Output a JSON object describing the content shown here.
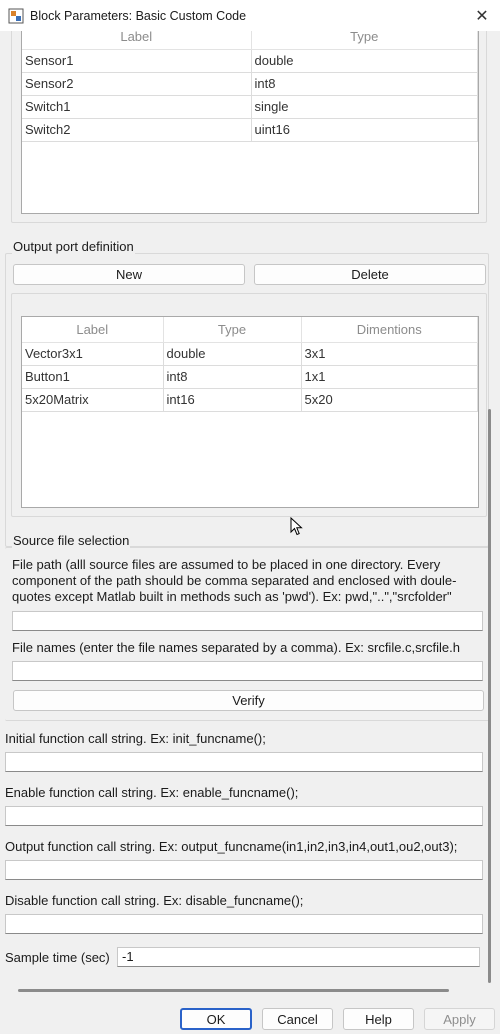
{
  "window": {
    "title": "Block Parameters: Basic Custom Code"
  },
  "input_ports": {
    "columns": [
      "Label",
      "Type"
    ],
    "rows": [
      [
        "Sensor1",
        "double"
      ],
      [
        "Sensor2",
        "int8"
      ],
      [
        "Switch1",
        "single"
      ],
      [
        "Switch2",
        "uint16"
      ]
    ]
  },
  "output_ports": {
    "group_title": "Output port definition",
    "new_label": "New",
    "delete_label": "Delete",
    "columns": [
      "Label",
      "Type",
      "Dimentions"
    ],
    "rows": [
      [
        "Vector3x1",
        "double",
        "3x1"
      ],
      [
        "Button1",
        "int8",
        "1x1"
      ],
      [
        "5x20Matrix",
        "int16",
        "5x20"
      ]
    ]
  },
  "source_files": {
    "group_title": "Source file selection",
    "path_description": "File path (alll source files are assumed to be placed in one directory. Every component of the path should be comma separated and enclosed with doule-quotes except Matlab built in methods such as 'pwd'). Ex: pwd,\"..\",\"srcfolder\"",
    "path_value": "",
    "names_description": "File names (enter the file names separated by a comma). Ex: srcfile.c,srcfile.h",
    "names_value": "",
    "verify_label": "Verify"
  },
  "functions": {
    "initial_label": "Initial function call string. Ex: init_funcname();",
    "initial_value": "",
    "enable_label": "Enable function call string. Ex: enable_funcname();",
    "enable_value": "",
    "output_label": "Output function call string. Ex: output_funcname(in1,in2,in3,in4,out1,ou2,out3);",
    "output_value": "",
    "disable_label": "Disable function call string. Ex: disable_funcname();",
    "disable_value": "",
    "sample_time_label": "Sample time (sec)",
    "sample_time_value": "-1"
  },
  "footer": {
    "ok": "OK",
    "cancel": "Cancel",
    "help": "Help",
    "apply": "Apply"
  },
  "colors": {
    "accent": "#2a62c9",
    "background": "#f0f0f0"
  },
  "icons": [
    "app-icon",
    "close-icon",
    "mouse-cursor-icon"
  ]
}
